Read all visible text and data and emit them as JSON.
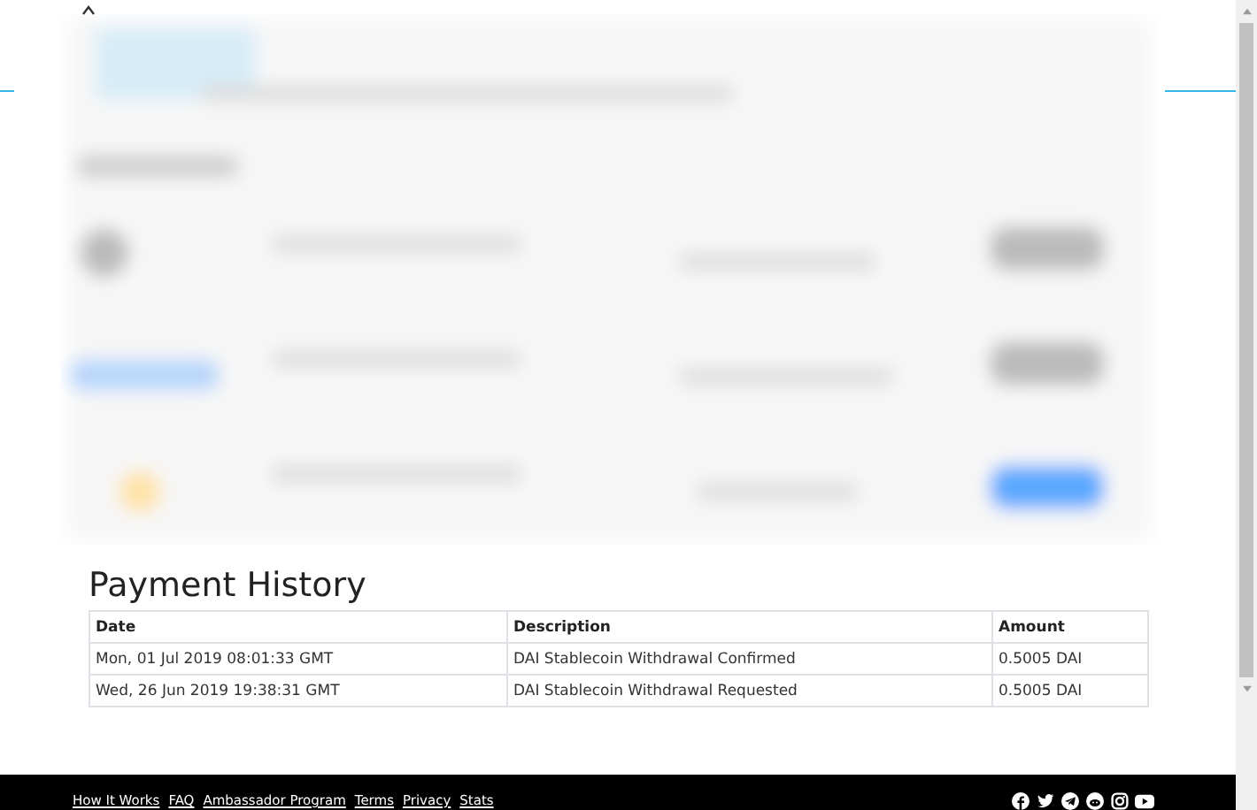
{
  "history": {
    "title": "Payment History",
    "columns": [
      "Date",
      "Description",
      "Amount"
    ],
    "rows": [
      {
        "date": "Mon, 01 Jul 2019 08:01:33 GMT",
        "description": "DAI Stablecoin Withdrawal Confirmed",
        "amount": "0.5005 DAI"
      },
      {
        "date": "Wed, 26 Jun 2019 19:38:31 GMT",
        "description": "DAI Stablecoin Withdrawal Requested",
        "amount": "0.5005 DAI"
      }
    ]
  },
  "footer": {
    "links": [
      "How It Works",
      "FAQ",
      "Ambassador Program",
      "Terms",
      "Privacy",
      "Stats"
    ],
    "social": [
      {
        "kind": "facebook"
      },
      {
        "kind": "twitter"
      },
      {
        "kind": "telegram"
      },
      {
        "kind": "reddit"
      },
      {
        "kind": "instagram"
      },
      {
        "kind": "youtube"
      }
    ]
  }
}
